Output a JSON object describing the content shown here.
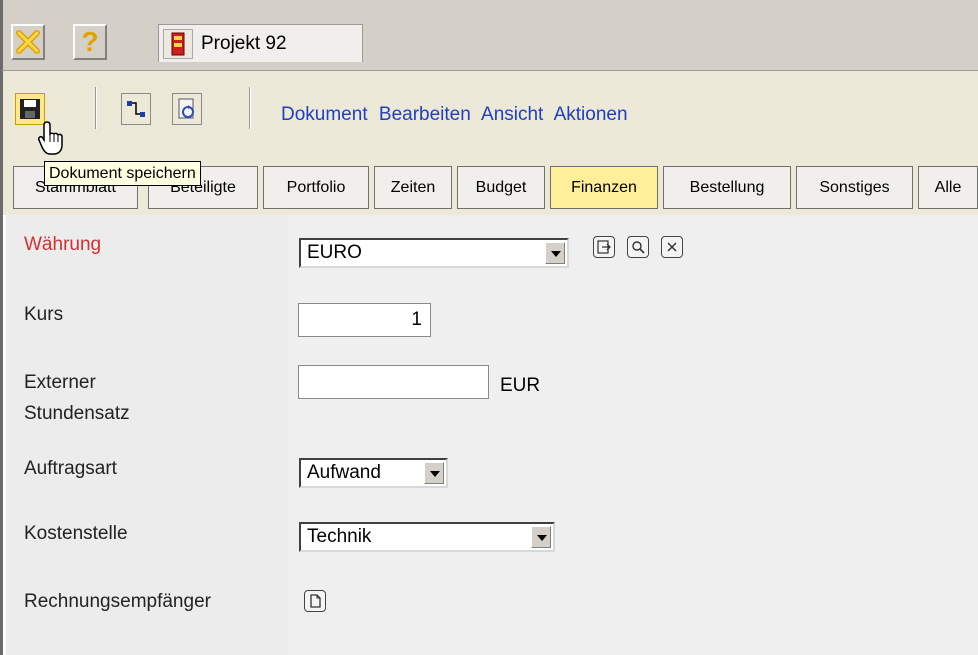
{
  "window": {
    "tab_title": "Projekt 92",
    "help_glyph": "?"
  },
  "toolbar": {
    "icons": [
      "save-icon",
      "workflow-icon",
      "refresh-icon"
    ],
    "menu": [
      "Dokument",
      "Bearbeiten",
      "Ansicht",
      "Aktionen"
    ],
    "tooltip": "Dokument speichern"
  },
  "tabs": [
    {
      "label": "Stammblatt"
    },
    {
      "label": "Beteiligte"
    },
    {
      "label": "Portfolio"
    },
    {
      "label": "Zeiten"
    },
    {
      "label": "Budget"
    },
    {
      "label": "Finanzen",
      "active": true
    },
    {
      "label": "Bestellung"
    },
    {
      "label": "Sonstiges"
    },
    {
      "label": "Alle"
    }
  ],
  "form": {
    "waehrung": {
      "label": "Währung",
      "value": "EURO",
      "required": true
    },
    "kurs": {
      "label": "Kurs",
      "value": "1"
    },
    "stundensatz": {
      "label_line1": "Externer",
      "label_line2": "Stundensatz",
      "value": "",
      "unit": "EUR"
    },
    "auftragsart": {
      "label": "Auftragsart",
      "value": "Aufwand"
    },
    "kostenstelle": {
      "label": "Kostenstelle",
      "value": "Technik"
    },
    "rechnungsempfaenger": {
      "label": "Rechnungsempfänger"
    }
  },
  "colors": {
    "menu_link": "#1f3fbf",
    "required_label": "#d43030",
    "active_tab": "#ffef9a",
    "tooltip_bg": "#ffffe1"
  }
}
